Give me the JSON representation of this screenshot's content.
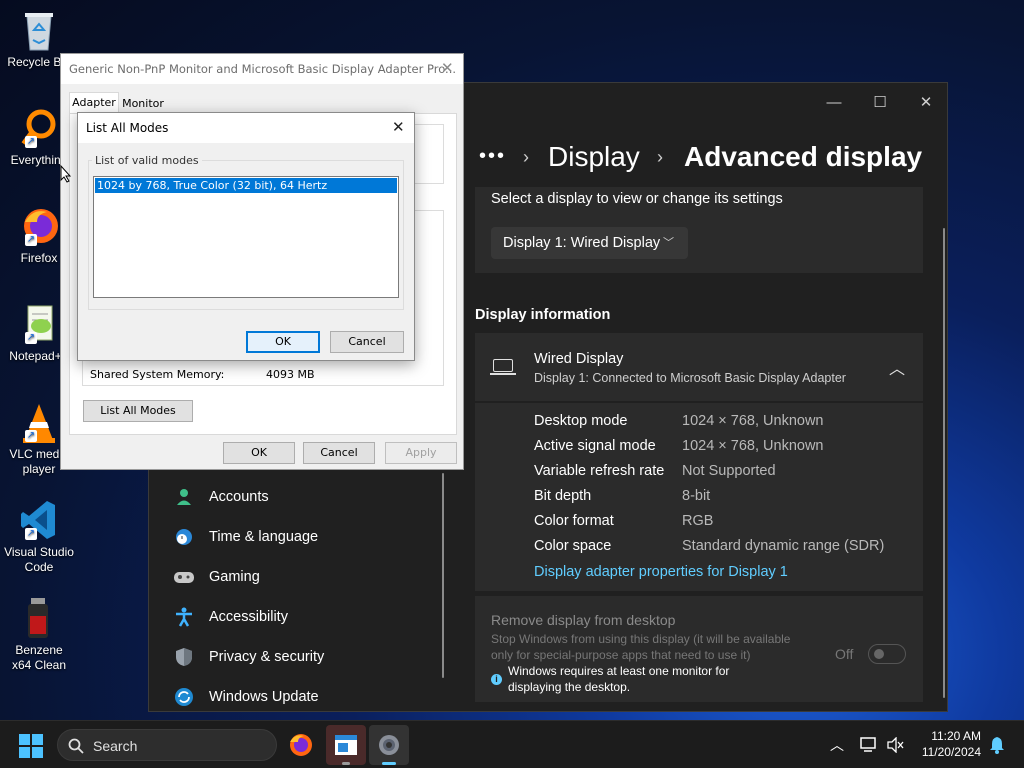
{
  "desktop_icons": [
    {
      "label": "Recycle Bin",
      "icon": "recycle-bin-icon"
    },
    {
      "label": "Everything",
      "icon": "everything-search-icon"
    },
    {
      "label": "Firefox",
      "icon": "firefox-icon"
    },
    {
      "label": "Notepad++",
      "icon": "notepad-plus-plus-icon"
    },
    {
      "label": "VLC media player",
      "icon": "vlc-icon"
    },
    {
      "label": "Visual Studio Code",
      "icon": "vscode-icon"
    },
    {
      "label": "Benzene x64 Clean",
      "icon": "benzene-icon"
    }
  ],
  "settings": {
    "breadcrumb_more": "•••",
    "breadcrumb_parent": "Display",
    "breadcrumb_current": "Advanced display",
    "select_display_label": "Select a display to view or change its settings",
    "display_dropdown_value": "Display 1: Wired Display",
    "display_info_heading": "Display information",
    "display_name": "Wired Display",
    "display_subtitle": "Display 1: Connected to Microsoft Basic Display Adapter",
    "info_rows": [
      {
        "label": "Desktop mode",
        "value": "1024 × 768, Unknown"
      },
      {
        "label": "Active signal mode",
        "value": "1024 × 768, Unknown"
      },
      {
        "label": "Variable refresh rate",
        "value": "Not Supported"
      },
      {
        "label": "Bit depth",
        "value": "8-bit"
      },
      {
        "label": "Color format",
        "value": "RGB"
      },
      {
        "label": "Color space",
        "value": "Standard dynamic range (SDR)"
      }
    ],
    "adapter_link": "Display adapter properties for Display 1",
    "remove_title": "Remove display from desktop",
    "remove_desc_1": "Stop Windows from using this display (it will be available",
    "remove_desc_2": "only for special-purpose apps that need to use it)",
    "remove_toggle_label": "Off",
    "remove_note_1": "Windows requires at least one monitor for",
    "remove_note_2": "displaying the desktop.",
    "sidebar": [
      {
        "label": "Accounts",
        "icon": "accounts-icon"
      },
      {
        "label": "Time & language",
        "icon": "time-language-icon"
      },
      {
        "label": "Gaming",
        "icon": "gaming-icon"
      },
      {
        "label": "Accessibility",
        "icon": "accessibility-icon"
      },
      {
        "label": "Privacy & security",
        "icon": "privacy-shield-icon"
      },
      {
        "label": "Windows Update",
        "icon": "windows-update-icon"
      }
    ]
  },
  "properties_dialog": {
    "title": "Generic Non-PnP Monitor and Microsoft Basic Display Adapter Pro...",
    "tabs": [
      "Adapter",
      "Monitor"
    ],
    "shared_memory_label": "Shared System Memory:",
    "shared_memory_value": "4093 MB",
    "list_all_modes_button": "List All Modes",
    "ok": "OK",
    "cancel": "Cancel",
    "apply": "Apply"
  },
  "modes_dialog": {
    "title": "List All Modes",
    "group_label": "List of valid modes",
    "modes": [
      "1024 by 768, True Color (32 bit), 64 Hertz"
    ],
    "ok": "OK",
    "cancel": "Cancel"
  },
  "taskbar": {
    "search_placeholder": "Search",
    "time": "11:20 AM",
    "date": "11/20/2024"
  }
}
